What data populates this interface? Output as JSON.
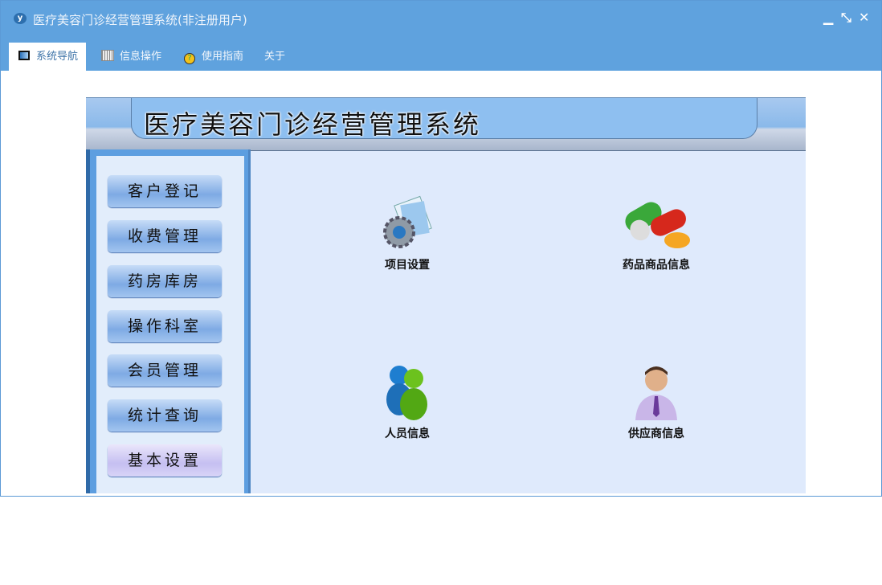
{
  "window": {
    "title": "医疗美容门诊经营管理系统(非注册用户)",
    "logo": "yf"
  },
  "tabs": [
    {
      "label": "系统导航",
      "icon": "monitor-icon"
    },
    {
      "label": "信息操作",
      "icon": "grid-icon"
    },
    {
      "label": "使用指南",
      "icon": "help-icon"
    },
    {
      "label": "关于"
    }
  ],
  "header": {
    "title": "医疗美容门诊经营管理系统"
  },
  "menu": [
    "客户登记",
    "收费管理",
    "药房库房",
    "操作科室",
    "会员管理",
    "统计查询",
    "基本设置"
  ],
  "tiles": [
    {
      "label": "项目设置",
      "icon": "settings-gear-icon"
    },
    {
      "label": "药品商品信息",
      "icon": "pills-icon"
    },
    {
      "label": "人员信息",
      "icon": "people-icon"
    },
    {
      "label": "供应商信息",
      "icon": "supplier-person-icon"
    }
  ]
}
